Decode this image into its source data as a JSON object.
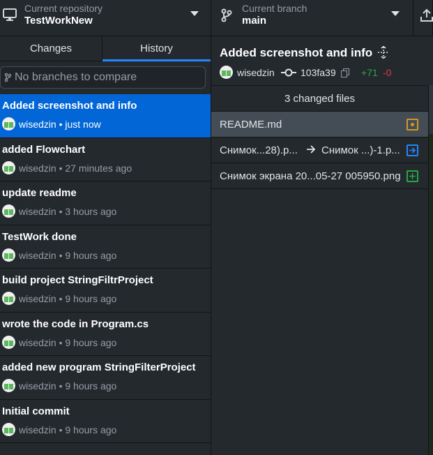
{
  "toolbar": {
    "repo": {
      "label": "Current repository",
      "value": "TestWorkNew"
    },
    "branch": {
      "label": "Current branch",
      "value": "main"
    }
  },
  "tabs": {
    "changes": "Changes",
    "history": "History"
  },
  "compare": {
    "placeholder": "No branches to compare"
  },
  "commits": [
    {
      "title": "Added screenshot and info",
      "meta": "wisedzin • just now"
    },
    {
      "title": "added Flowchart",
      "meta": "wisedzin • 27 minutes ago"
    },
    {
      "title": "update readme",
      "meta": "wisedzin • 3 hours ago"
    },
    {
      "title": "TestWork done",
      "meta": "wisedzin • 9 hours ago"
    },
    {
      "title": "build project StringFiltrProject",
      "meta": "wisedzin • 9 hours ago"
    },
    {
      "title": "wrote the code in Program.cs",
      "meta": "wisedzin • 9 hours ago"
    },
    {
      "title": "added new program StringFilterProject",
      "meta": "wisedzin • 9 hours ago"
    },
    {
      "title": "Initial commit",
      "meta": "wisedzin • 9 hours ago"
    }
  ],
  "commit_detail": {
    "title": "Added screenshot and info",
    "author": "wisedzin",
    "sha": "103fa39",
    "additions": "+71",
    "deletions": "-0"
  },
  "files": {
    "header": "3 changed files",
    "items": [
      {
        "name": "README.md",
        "status": "modified"
      },
      {
        "name": "Снимок...28).p...",
        "renamed_to": "Снимок ...)-1.p...",
        "status": "renamed"
      },
      {
        "name": "Снимок экрана 20...05-27 005950.png",
        "status": "added"
      }
    ]
  },
  "colors": {
    "accent": "#0366d6",
    "added": "#28a745",
    "deleted": "#d73a49",
    "modified": "#d29922",
    "renamed": "#2188ff"
  }
}
